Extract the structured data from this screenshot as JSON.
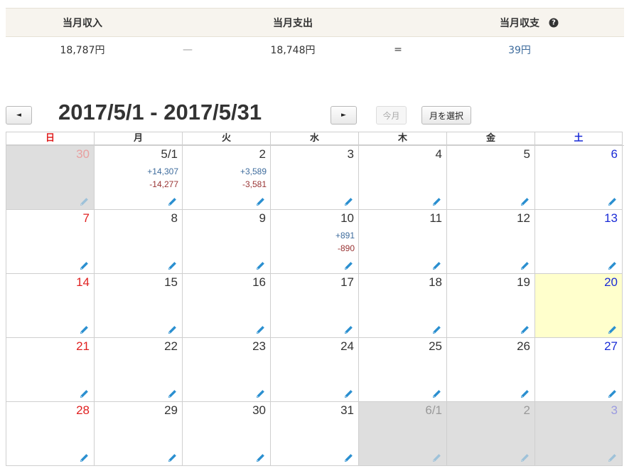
{
  "summary": {
    "headers": {
      "income": "当月収入",
      "expense": "当月支出",
      "balance": "当月収支"
    },
    "values": {
      "income": "18,787円",
      "minus": "—",
      "expense": "18,748円",
      "equal": "=",
      "balance": "39円"
    }
  },
  "toolbar": {
    "prev_label": "◄",
    "next_label": "►",
    "range_title": "2017/5/1 - 2017/5/31",
    "today_label": "今月",
    "pick_month_label": "月を選択"
  },
  "weekdays": [
    "日",
    "月",
    "火",
    "水",
    "木",
    "金",
    "土"
  ],
  "weeks": [
    [
      {
        "label": "30",
        "other": true
      },
      {
        "label": "5/1",
        "income": "+14,307",
        "expense": "-14,277"
      },
      {
        "label": "2",
        "income": "+3,589",
        "expense": "-3,581"
      },
      {
        "label": "3"
      },
      {
        "label": "4"
      },
      {
        "label": "5"
      },
      {
        "label": "6"
      }
    ],
    [
      {
        "label": "7"
      },
      {
        "label": "8"
      },
      {
        "label": "9"
      },
      {
        "label": "10",
        "income": "+891",
        "expense": "-890"
      },
      {
        "label": "11"
      },
      {
        "label": "12"
      },
      {
        "label": "13"
      }
    ],
    [
      {
        "label": "14"
      },
      {
        "label": "15"
      },
      {
        "label": "16"
      },
      {
        "label": "17"
      },
      {
        "label": "18"
      },
      {
        "label": "19"
      },
      {
        "label": "20",
        "today": true
      }
    ],
    [
      {
        "label": "21"
      },
      {
        "label": "22"
      },
      {
        "label": "23"
      },
      {
        "label": "24"
      },
      {
        "label": "25"
      },
      {
        "label": "26"
      },
      {
        "label": "27"
      }
    ],
    [
      {
        "label": "28"
      },
      {
        "label": "29"
      },
      {
        "label": "30"
      },
      {
        "label": "31"
      },
      {
        "label": "6/1",
        "other": true
      },
      {
        "label": "2",
        "other": true
      },
      {
        "label": "3",
        "other": true
      }
    ]
  ],
  "colors": {
    "income": "#3d6b9c",
    "expense": "#993333",
    "sunday": "#e02020",
    "saturday": "#1a2bd6",
    "today_bg": "#ffffcc",
    "other_bg": "#dedede",
    "pencil": "#2a8fd0"
  },
  "icons": {
    "help": "question-circle-icon",
    "edit": "pencil-icon"
  }
}
